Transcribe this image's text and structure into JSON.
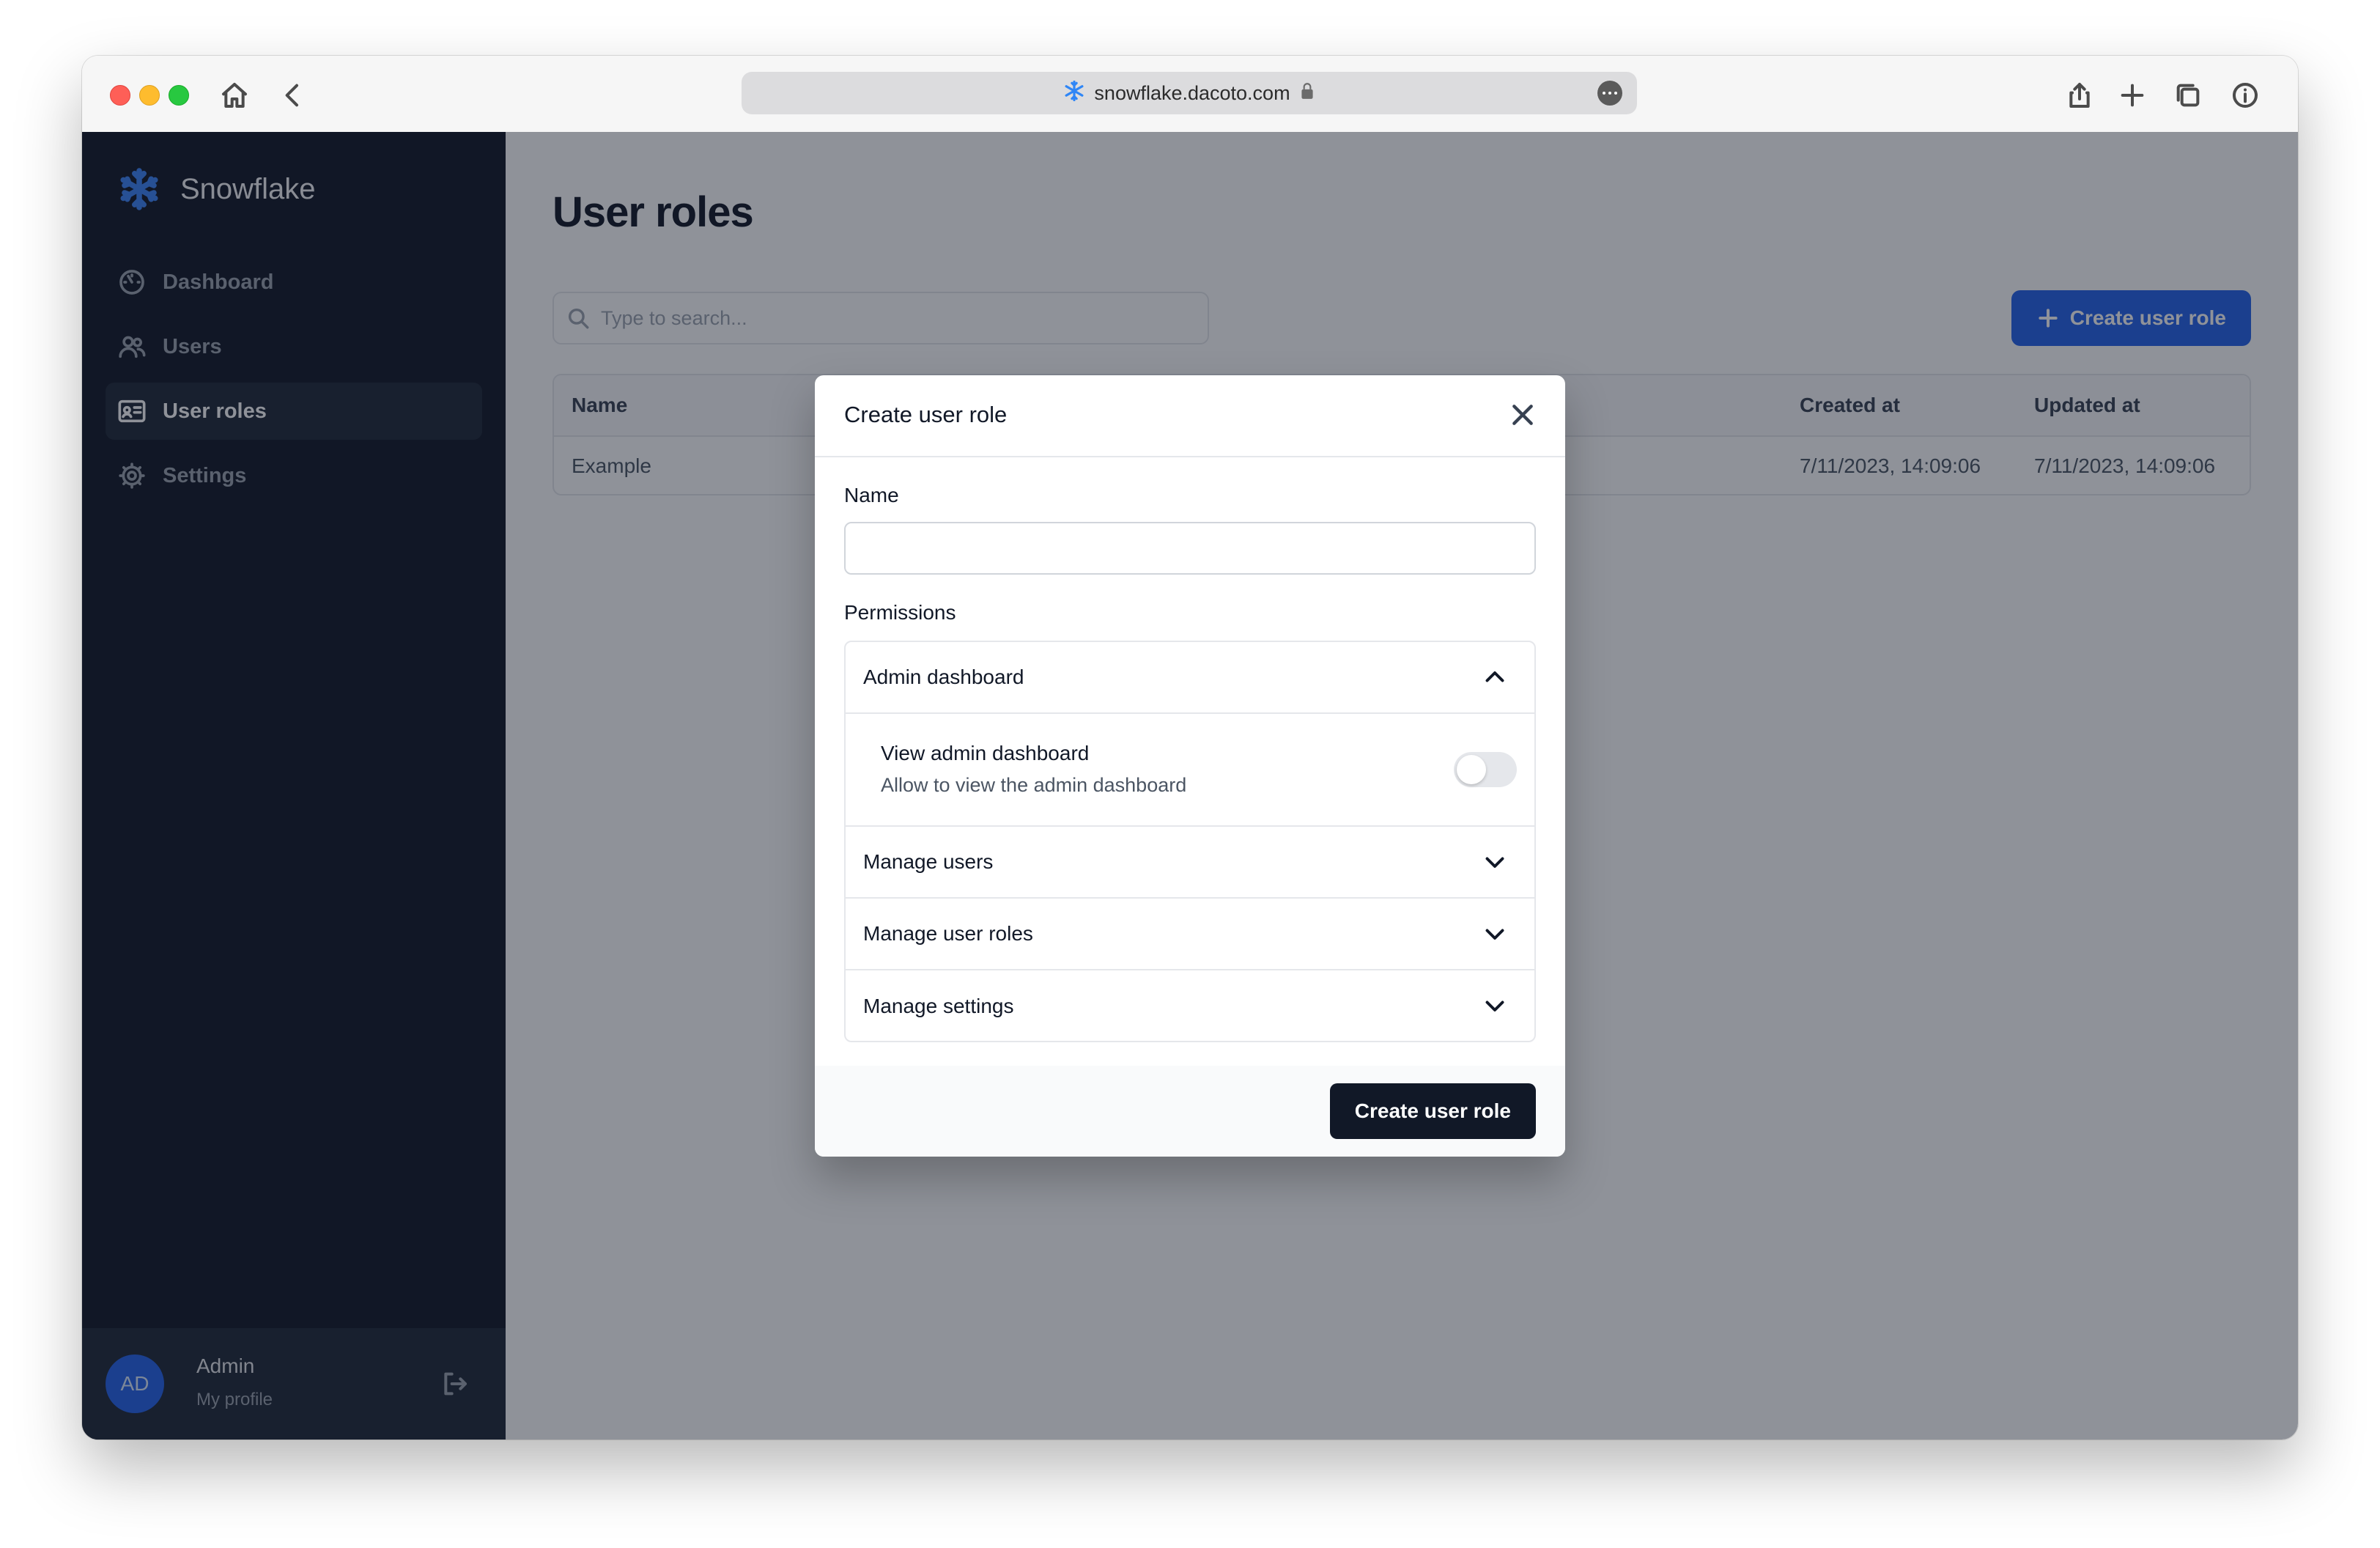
{
  "browser": {
    "url": "snowflake.dacoto.com"
  },
  "app": {
    "brand": "Snowflake",
    "nav": [
      {
        "label": "Dashboard",
        "icon": "dashboard-icon"
      },
      {
        "label": "Users",
        "icon": "users-icon"
      },
      {
        "label": "User roles",
        "icon": "id-card-icon",
        "active": true
      },
      {
        "label": "Settings",
        "icon": "gear-icon"
      }
    ],
    "user": {
      "initials": "AD",
      "name": "Admin",
      "subtitle": "My profile"
    }
  },
  "page": {
    "title": "User roles",
    "search_placeholder": "Type to search...",
    "create_button": "Create user role",
    "table": {
      "headers": [
        "Name",
        "Created at",
        "Updated at"
      ],
      "rows": [
        [
          "Example",
          "7/11/2023, 14:09:06",
          "7/11/2023, 14:09:06"
        ]
      ]
    }
  },
  "modal": {
    "title": "Create user role",
    "name_label": "Name",
    "name_value": "",
    "permissions_label": "Permissions",
    "groups": [
      {
        "label": "Admin dashboard",
        "expanded": true,
        "items": [
          {
            "title": "View admin dashboard",
            "description": "Allow to view the admin dashboard",
            "enabled": false
          }
        ]
      },
      {
        "label": "Manage users",
        "expanded": false
      },
      {
        "label": "Manage user roles",
        "expanded": false
      },
      {
        "label": "Manage settings",
        "expanded": false
      }
    ],
    "submit": "Create user role"
  },
  "colors": {
    "accent": "#2563eb",
    "sidebar": "#111827",
    "overlay": "rgba(17,24,39,0.47)"
  }
}
